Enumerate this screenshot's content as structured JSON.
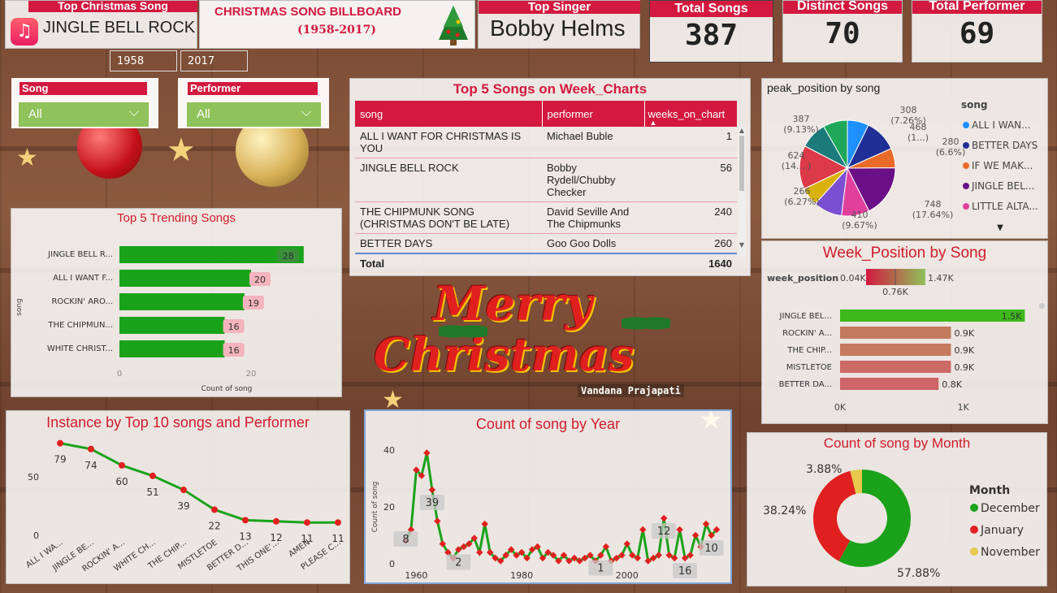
{
  "header": {
    "top_song_title": "Top Christmas Song",
    "top_song_value": "JINGLE BELL ROCK",
    "billboard_title": "CHRISTMAS SONG BILLBOARD",
    "billboard_years": "(1958-2017)",
    "top_singer_title": "Top Singer",
    "top_singer_value": "Bobby Helms",
    "year_from": "1958",
    "year_to": "2017"
  },
  "kpis": {
    "total_songs_label": "Total Songs",
    "total_songs_value": "387",
    "distinct_songs_label": "Distinct Songs",
    "distinct_songs_value": "70",
    "total_performer_label": "Total Performer",
    "total_performer_value": "69"
  },
  "slicers": {
    "song_label": "Song",
    "song_value": "All",
    "performer_label": "Performer",
    "performer_value": "All"
  },
  "week_table": {
    "title": "Top 5 Songs on Week_Charts",
    "headers": [
      "song",
      "performer",
      "weeks_on_chart"
    ],
    "rows": [
      {
        "song": "ALL I WANT FOR CHRISTMAS IS YOU",
        "performer": "Michael Buble",
        "weeks": "1"
      },
      {
        "song": "JINGLE BELL ROCK",
        "performer": "Bobby Rydell/Chubby Checker",
        "weeks": "56"
      },
      {
        "song": "THE CHIPMUNK SONG (CHRISTMAS DON'T BE LATE)",
        "performer": "David Seville And The Chipmunks",
        "weeks": "240"
      },
      {
        "song": "BETTER DAYS",
        "performer": "Goo Goo Dolls",
        "weeks": "260"
      }
    ],
    "total_label": "Total",
    "total_value": "1640"
  },
  "watermark": "Vandana Prajapati",
  "greeting": {
    "line1": "Merry",
    "line2": "Christmas"
  },
  "chart_data": [
    {
      "id": "trending",
      "type": "bar",
      "title": "Top 5 Trending Songs",
      "ylabel": "song",
      "xlabel": "Count of song",
      "categories": [
        "JINGLE BELL R...",
        "ALL I WANT F...",
        "ROCKIN' ARO...",
        "THE CHIPMUN...",
        "WHITE CHRIST..."
      ],
      "values": [
        28,
        20,
        19,
        16,
        16
      ],
      "xticks": [
        "0",
        "20"
      ],
      "xlim": [
        0,
        30
      ],
      "color": "#1aa31a"
    },
    {
      "id": "peak_pie",
      "type": "pie",
      "title": "peak_position by song",
      "legend_title": "song",
      "legend": [
        "ALL I WAN...",
        "BETTER DAYS",
        "IF WE MAK...",
        "JINGLE BEL...",
        "LITTLE ALTA..."
      ],
      "slices": [
        {
          "value": 308,
          "label": "308 (7.26%)",
          "color": "#1e90ff"
        },
        {
          "value": 468,
          "label": "468 (1...)",
          "color": "#1f2f96"
        },
        {
          "value": 280,
          "label": "280 (6.6%)",
          "color": "#ea6a2a"
        },
        {
          "value": 748,
          "label": "748 (17.64%)",
          "color": "#6a0f86"
        },
        {
          "value": 400,
          "label": "",
          "color": "#e0409c"
        },
        {
          "value": 410,
          "label": "410 (9.67%)",
          "color": "#7b4fd1"
        },
        {
          "value": 266,
          "label": "266 (6.27%)",
          "color": "#d9b20f"
        },
        {
          "value": 624,
          "label": "624 (14....)",
          "color": "#dc3949"
        },
        {
          "value": 387,
          "label": "387 (9.13%)",
          "color": "#1b7a7a"
        },
        {
          "value": 349,
          "label": "",
          "color": "#1fa85a"
        }
      ],
      "legend_colors": [
        "#1e90ff",
        "#1f2f96",
        "#ea6a2a",
        "#6a0f86",
        "#e0409c"
      ]
    },
    {
      "id": "week_position",
      "type": "bar",
      "title": "Week_Position by Song",
      "legend_label": "week_position",
      "gradient_min": "0.04K",
      "gradient_mid": "0.76K",
      "gradient_max": "1.47K",
      "categories": [
        "JINGLE BEL...",
        "ROCKIN' A...",
        "THE CHIP...",
        "MISTLETOE",
        "BETTER DA..."
      ],
      "values": [
        1.5,
        0.9,
        0.9,
        0.9,
        0.8
      ],
      "labels": [
        "1.5K",
        "0.9K",
        "0.9K",
        "0.9K",
        "0.8K"
      ],
      "colors": [
        "#3cb81a",
        "#c17a5c",
        "#c5795f",
        "#cc6a66",
        "#ce6568"
      ],
      "xticks": [
        "0K",
        "1K"
      ],
      "xlim": [
        0,
        1.55
      ]
    },
    {
      "id": "instance",
      "type": "line",
      "title": "Instance by Top 10 songs and Performer",
      "categories": [
        "ALL I WA...",
        "JINGLE BE...",
        "ROCKIN' A...",
        "WHITE CH...",
        "THE CHIP...",
        "MISTLETOE",
        "BETTER D...",
        "THIS ONE'...",
        "AMEN",
        "PLEASE C..."
      ],
      "values": [
        79,
        74,
        60,
        51,
        39,
        22,
        13,
        12,
        11,
        11
      ],
      "yticks": [
        "0",
        "50"
      ],
      "ylim": [
        0,
        85
      ],
      "line_color": "#1aa31a",
      "marker_color": "#e0201e"
    },
    {
      "id": "by_year",
      "type": "line",
      "title": "Count of song by Year",
      "ylabel": "Count of song",
      "x": [
        1958,
        1959,
        1960,
        1961,
        1962,
        1963,
        1964,
        1965,
        1966,
        1967,
        1968,
        1969,
        1970,
        1971,
        1972,
        1973,
        1974,
        1975,
        1976,
        1977,
        1978,
        1979,
        1980,
        1981,
        1982,
        1983,
        1984,
        1985,
        1986,
        1987,
        1988,
        1989,
        1990,
        1991,
        1992,
        1993,
        1994,
        1995,
        1996,
        1997,
        1998,
        1999,
        2000,
        2001,
        2002,
        2003,
        2004,
        2005,
        2006,
        2007,
        2008,
        2009,
        2010,
        2011,
        2012,
        2013,
        2014,
        2015,
        2016,
        2017
      ],
      "values": [
        8,
        12,
        33,
        31,
        39,
        26,
        15,
        7,
        4,
        2,
        5,
        6,
        7,
        9,
        4,
        14,
        4,
        2,
        1,
        3,
        5,
        3,
        4,
        2,
        5,
        6,
        2,
        4,
        3,
        1,
        3,
        1,
        2,
        1,
        2,
        3,
        1,
        3,
        6,
        1,
        2,
        3,
        7,
        3,
        2,
        12,
        1,
        2,
        3,
        16,
        3,
        2,
        12,
        2,
        3,
        10,
        6,
        14,
        10,
        12
      ],
      "labels": [
        {
          "x": 1958,
          "text": "8"
        },
        {
          "x": 1963,
          "text": "39"
        },
        {
          "x": 1968,
          "text": "2"
        },
        {
          "x": 1995,
          "text": "1"
        },
        {
          "x": 2007,
          "text": "12"
        },
        {
          "x": 2011,
          "text": "16"
        },
        {
          "x": 2016,
          "text": "10"
        }
      ],
      "xticks": [
        "1960",
        "1980",
        "2000"
      ],
      "yticks": [
        "0",
        "20",
        "40"
      ],
      "xlim": [
        1955,
        2019
      ],
      "ylim": [
        0,
        40
      ],
      "line_color": "#1aa31a",
      "marker_color": "#e0201e"
    },
    {
      "id": "by_month",
      "type": "pie",
      "title": "Count of song by Month",
      "legend_title": "Month",
      "slices": [
        {
          "name": "December",
          "value": 57.88,
          "label": "57.88%",
          "color": "#1aa31a"
        },
        {
          "name": "January",
          "value": 38.24,
          "label": "38.24%",
          "color": "#e0201e"
        },
        {
          "name": "November",
          "value": 3.88,
          "label": "3.88%",
          "color": "#e6c94d"
        }
      ]
    }
  ]
}
